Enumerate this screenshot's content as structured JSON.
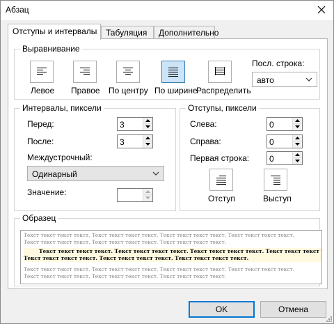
{
  "window": {
    "title": "Абзац"
  },
  "tabs": [
    {
      "label": "Отступы и интервалы",
      "active": true
    },
    {
      "label": "Табуляция",
      "active": false
    },
    {
      "label": "Дополнительно",
      "active": false
    }
  ],
  "alignment": {
    "group_label": "Выравнивание",
    "buttons": [
      {
        "label": "Левое",
        "icon": "align-left-icon",
        "selected": false
      },
      {
        "label": "Правое",
        "icon": "align-right-icon",
        "selected": false
      },
      {
        "label": "По центру",
        "icon": "align-center-icon",
        "selected": false
      },
      {
        "label": "По ширине",
        "icon": "align-justify-icon",
        "selected": true
      },
      {
        "label": "Распределить",
        "icon": "distribute-icon",
        "selected": false
      }
    ],
    "last_line_label": "Посл. строка:",
    "last_line_value": "авто"
  },
  "spacing": {
    "group_label": "Интервалы, пиксели",
    "before_label": "Перед:",
    "before_value": "3",
    "after_label": "После:",
    "after_value": "3",
    "line_label": "Междустрочный:",
    "line_value": "Одинарный",
    "value_label": "Значение:",
    "value_value": ""
  },
  "indents": {
    "group_label": "Отступы, пиксели",
    "left_label": "Слева:",
    "left_value": "0",
    "right_label": "Справа:",
    "right_value": "0",
    "first_line_label": "Первая строка:",
    "first_line_value": "0",
    "indent_button_label": "Отступ",
    "outdent_button_label": "Выступ"
  },
  "sample": {
    "group_label": "Образец",
    "prev_lines": [
      "Текст текст текст текст. Текст текст текст текст. Текст текст текст текст. Текст текст текст текст.",
      "Текст текст текст текст. Текст текст текст текст. Текст текст текст текст."
    ],
    "current_lines": [
      "Текст текст текст текст. Текст текст текст текст. Текст текст текст текст. Текст текст текст текст.",
      "Текст текст текст текст. Текст текст текст текст. Текст текст текст текст."
    ],
    "next_lines": [
      "Текст текст текст текст. Текст текст текст текст. Текст текст текст текст. Текст текст текст текст.",
      "Текст текст текст текст. Текст текст текст текст. Текст текст текст текст."
    ]
  },
  "footer": {
    "ok_label": "OK",
    "cancel_label": "Отмена"
  }
}
